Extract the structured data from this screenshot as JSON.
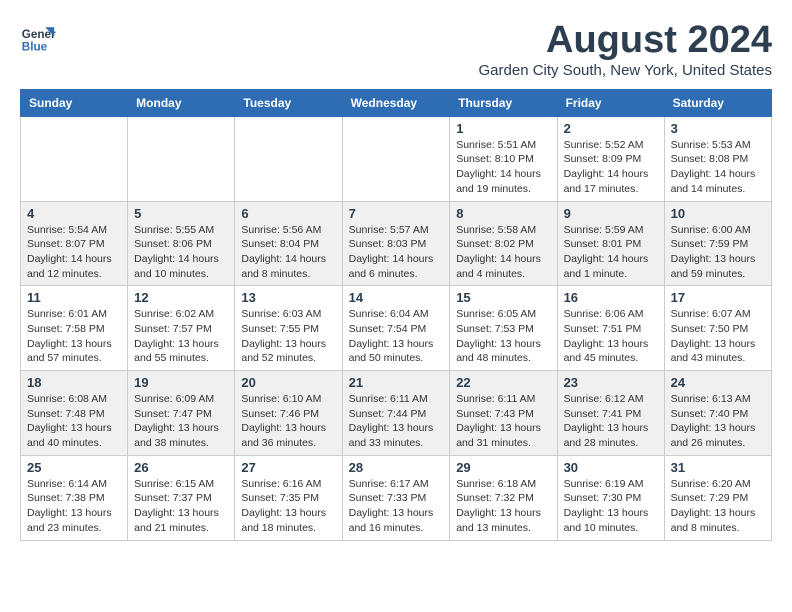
{
  "header": {
    "logo_line1": "General",
    "logo_line2": "Blue",
    "month_year": "August 2024",
    "location": "Garden City South, New York, United States"
  },
  "days_of_week": [
    "Sunday",
    "Monday",
    "Tuesday",
    "Wednesday",
    "Thursday",
    "Friday",
    "Saturday"
  ],
  "weeks": [
    [
      {
        "day": "",
        "info": ""
      },
      {
        "day": "",
        "info": ""
      },
      {
        "day": "",
        "info": ""
      },
      {
        "day": "",
        "info": ""
      },
      {
        "day": "1",
        "info": "Sunrise: 5:51 AM\nSunset: 8:10 PM\nDaylight: 14 hours\nand 19 minutes."
      },
      {
        "day": "2",
        "info": "Sunrise: 5:52 AM\nSunset: 8:09 PM\nDaylight: 14 hours\nand 17 minutes."
      },
      {
        "day": "3",
        "info": "Sunrise: 5:53 AM\nSunset: 8:08 PM\nDaylight: 14 hours\nand 14 minutes."
      }
    ],
    [
      {
        "day": "4",
        "info": "Sunrise: 5:54 AM\nSunset: 8:07 PM\nDaylight: 14 hours\nand 12 minutes."
      },
      {
        "day": "5",
        "info": "Sunrise: 5:55 AM\nSunset: 8:06 PM\nDaylight: 14 hours\nand 10 minutes."
      },
      {
        "day": "6",
        "info": "Sunrise: 5:56 AM\nSunset: 8:04 PM\nDaylight: 14 hours\nand 8 minutes."
      },
      {
        "day": "7",
        "info": "Sunrise: 5:57 AM\nSunset: 8:03 PM\nDaylight: 14 hours\nand 6 minutes."
      },
      {
        "day": "8",
        "info": "Sunrise: 5:58 AM\nSunset: 8:02 PM\nDaylight: 14 hours\nand 4 minutes."
      },
      {
        "day": "9",
        "info": "Sunrise: 5:59 AM\nSunset: 8:01 PM\nDaylight: 14 hours\nand 1 minute."
      },
      {
        "day": "10",
        "info": "Sunrise: 6:00 AM\nSunset: 7:59 PM\nDaylight: 13 hours\nand 59 minutes."
      }
    ],
    [
      {
        "day": "11",
        "info": "Sunrise: 6:01 AM\nSunset: 7:58 PM\nDaylight: 13 hours\nand 57 minutes."
      },
      {
        "day": "12",
        "info": "Sunrise: 6:02 AM\nSunset: 7:57 PM\nDaylight: 13 hours\nand 55 minutes."
      },
      {
        "day": "13",
        "info": "Sunrise: 6:03 AM\nSunset: 7:55 PM\nDaylight: 13 hours\nand 52 minutes."
      },
      {
        "day": "14",
        "info": "Sunrise: 6:04 AM\nSunset: 7:54 PM\nDaylight: 13 hours\nand 50 minutes."
      },
      {
        "day": "15",
        "info": "Sunrise: 6:05 AM\nSunset: 7:53 PM\nDaylight: 13 hours\nand 48 minutes."
      },
      {
        "day": "16",
        "info": "Sunrise: 6:06 AM\nSunset: 7:51 PM\nDaylight: 13 hours\nand 45 minutes."
      },
      {
        "day": "17",
        "info": "Sunrise: 6:07 AM\nSunset: 7:50 PM\nDaylight: 13 hours\nand 43 minutes."
      }
    ],
    [
      {
        "day": "18",
        "info": "Sunrise: 6:08 AM\nSunset: 7:48 PM\nDaylight: 13 hours\nand 40 minutes."
      },
      {
        "day": "19",
        "info": "Sunrise: 6:09 AM\nSunset: 7:47 PM\nDaylight: 13 hours\nand 38 minutes."
      },
      {
        "day": "20",
        "info": "Sunrise: 6:10 AM\nSunset: 7:46 PM\nDaylight: 13 hours\nand 36 minutes."
      },
      {
        "day": "21",
        "info": "Sunrise: 6:11 AM\nSunset: 7:44 PM\nDaylight: 13 hours\nand 33 minutes."
      },
      {
        "day": "22",
        "info": "Sunrise: 6:11 AM\nSunset: 7:43 PM\nDaylight: 13 hours\nand 31 minutes."
      },
      {
        "day": "23",
        "info": "Sunrise: 6:12 AM\nSunset: 7:41 PM\nDaylight: 13 hours\nand 28 minutes."
      },
      {
        "day": "24",
        "info": "Sunrise: 6:13 AM\nSunset: 7:40 PM\nDaylight: 13 hours\nand 26 minutes."
      }
    ],
    [
      {
        "day": "25",
        "info": "Sunrise: 6:14 AM\nSunset: 7:38 PM\nDaylight: 13 hours\nand 23 minutes."
      },
      {
        "day": "26",
        "info": "Sunrise: 6:15 AM\nSunset: 7:37 PM\nDaylight: 13 hours\nand 21 minutes."
      },
      {
        "day": "27",
        "info": "Sunrise: 6:16 AM\nSunset: 7:35 PM\nDaylight: 13 hours\nand 18 minutes."
      },
      {
        "day": "28",
        "info": "Sunrise: 6:17 AM\nSunset: 7:33 PM\nDaylight: 13 hours\nand 16 minutes."
      },
      {
        "day": "29",
        "info": "Sunrise: 6:18 AM\nSunset: 7:32 PM\nDaylight: 13 hours\nand 13 minutes."
      },
      {
        "day": "30",
        "info": "Sunrise: 6:19 AM\nSunset: 7:30 PM\nDaylight: 13 hours\nand 10 minutes."
      },
      {
        "day": "31",
        "info": "Sunrise: 6:20 AM\nSunset: 7:29 PM\nDaylight: 13 hours\nand 8 minutes."
      }
    ]
  ]
}
